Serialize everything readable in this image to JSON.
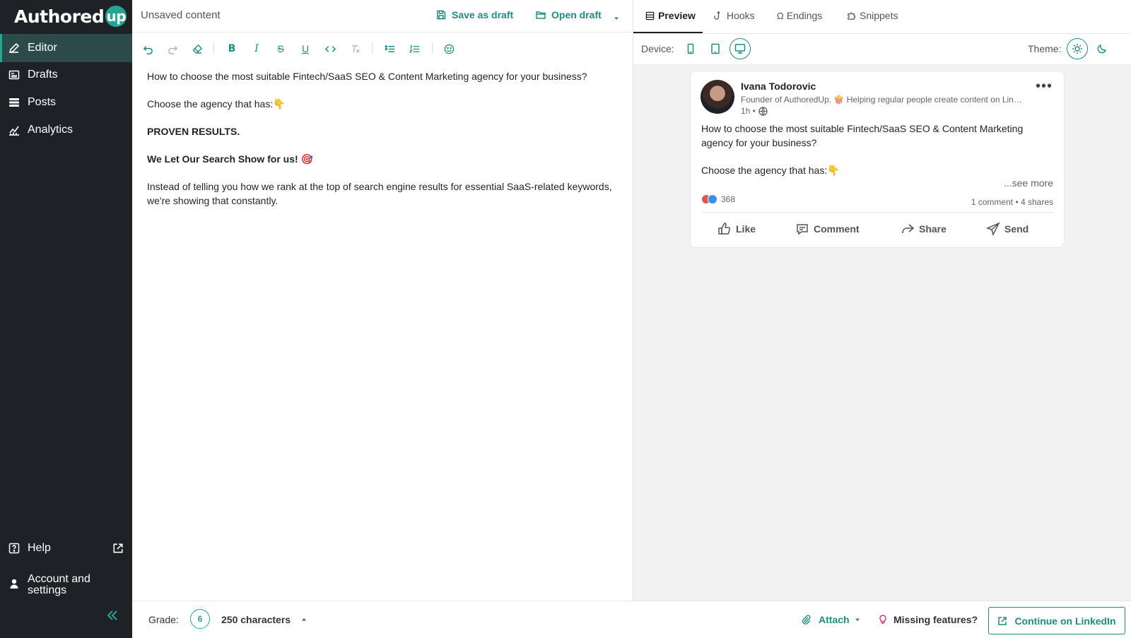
{
  "app": {
    "logo_text": "Authored",
    "logo_badge": "up",
    "accent_color": "#23a596",
    "sidebar_bg": "#1e2227"
  },
  "sidebar": {
    "items": [
      {
        "label": "Editor",
        "icon": "pencil-icon",
        "active": true
      },
      {
        "label": "Drafts",
        "icon": "drafts-icon"
      },
      {
        "label": "Posts",
        "icon": "posts-icon"
      },
      {
        "label": "Analytics",
        "icon": "analytics-icon"
      }
    ],
    "help_label": "Help",
    "account_label_line1": "Account and",
    "account_label_line2": "settings"
  },
  "editor_header": {
    "title": "Unsaved content",
    "save_label": "Save as draft",
    "open_label": "Open draft"
  },
  "editor": {
    "line1": "How to choose the most suitable Fintech/SaaS SEO & Content Marketing agency for your business?",
    "line2": "Choose the agency that has:👇",
    "line3": "PROVEN RESULTS.",
    "line4": "We Let Our Search Show for us! 🎯",
    "line5": "Instead of telling you how we rank at the top of search engine results for essential SaaS-related keywords, we're showing that constantly."
  },
  "right_tabs": [
    {
      "label": "Preview",
      "icon": "preview-icon",
      "active": true
    },
    {
      "label": "Hooks",
      "icon": "hook-icon"
    },
    {
      "label": "Endings",
      "icon": "omega-icon"
    },
    {
      "label": "Snippets",
      "icon": "puzzle-icon"
    }
  ],
  "device": {
    "label": "Device:",
    "theme_label": "Theme:",
    "active_device": "desktop",
    "active_theme": "light"
  },
  "preview": {
    "author": "Ivana Todorovic",
    "headline": "Founder of AuthoredUp. 🍿 Helping regular people create content on LinkedIn",
    "time": "1h •",
    "post_line1": "How to choose the most suitable Fintech/SaaS SEO & Content Marketing agency for your business?",
    "post_line2": "Choose the agency that has:👇",
    "see_more": "...see more",
    "reactions_count": "368",
    "engagement": "1 comment • 4 shares",
    "actions": {
      "like": "Like",
      "comment": "Comment",
      "share": "Share",
      "send": "Send"
    }
  },
  "bottom_bar": {
    "grade_label": "Grade:",
    "grade_value": "6",
    "characters": "250 characters",
    "attach_label": "Attach",
    "missing_label": "Missing features?",
    "continue_label": "Continue on LinkedIn"
  }
}
